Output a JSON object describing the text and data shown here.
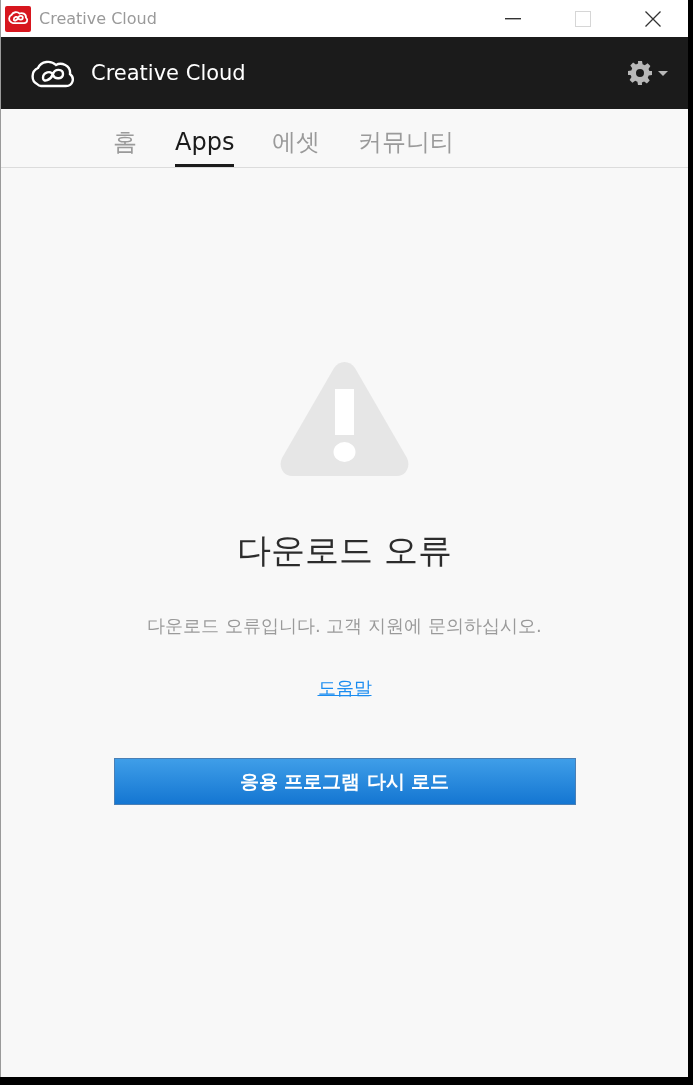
{
  "window": {
    "title": "Creative Cloud",
    "controls": [
      {
        "kind": "minimize",
        "disabled": false
      },
      {
        "kind": "maximize",
        "disabled": true
      },
      {
        "kind": "close",
        "disabled": false
      }
    ]
  },
  "header": {
    "title": "Creative Cloud"
  },
  "tabs": [
    {
      "label": "홈",
      "selected": false
    },
    {
      "label": "Apps",
      "selected": true
    },
    {
      "label": "에셋",
      "selected": false
    },
    {
      "label": "커뮤니티",
      "selected": false
    }
  ],
  "error": {
    "title": "다운로드 오류",
    "message": "다운로드 오류입니다. 고객 지원에 문의하십시오.",
    "help_link": "도움말",
    "button": "응용 프로그램 다시 로드"
  }
}
